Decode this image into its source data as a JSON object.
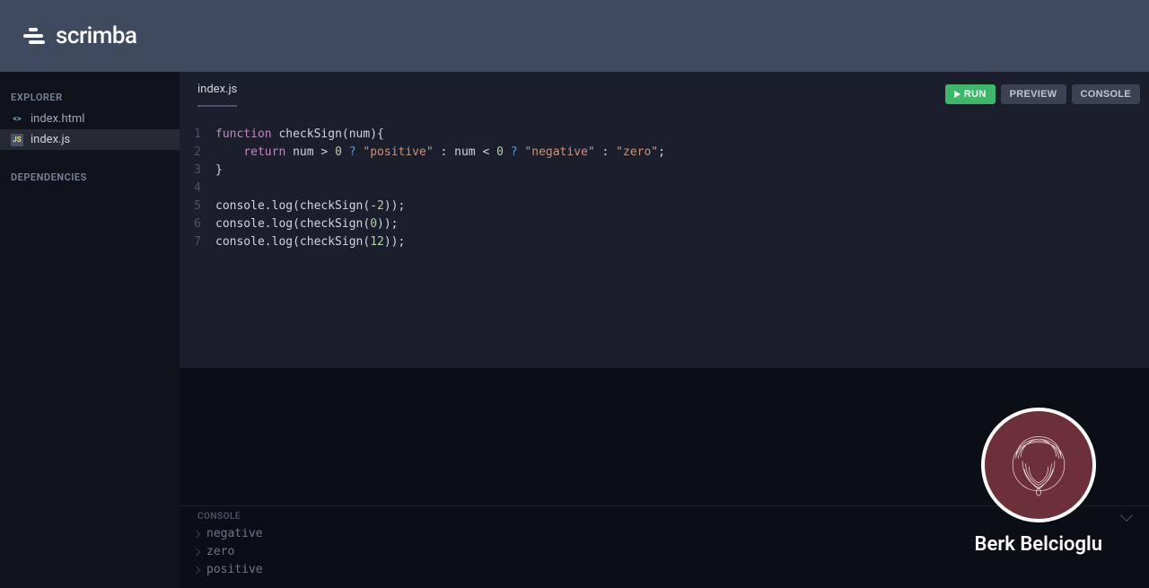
{
  "header": {
    "brand": "scrimba"
  },
  "sidebar": {
    "explorer_label": "EXPLORER",
    "dependencies_label": "DEPENDENCIES",
    "files": [
      {
        "name": "index.html",
        "icon": "html",
        "active": false
      },
      {
        "name": "index.js",
        "icon": "js",
        "active": true
      }
    ]
  },
  "editor": {
    "tab": "index.js",
    "run_label": "RUN",
    "preview_label": "PREVIEW",
    "console_label": "CONSOLE",
    "lines": {
      "l1_kw_function": "function",
      "l1_rest": " checkSign(num){",
      "l2_kw_return": "return",
      "l2_num1_pre": " num ",
      "l2_gt": ">",
      "l2_zero1": " 0 ",
      "l2_q1": "?",
      "l2_pos": " \"positive\" ",
      "l2_colon1": ":",
      "l2_num2_pre": " num ",
      "l2_lt": "<",
      "l2_zero2": " 0 ",
      "l2_q2": "?",
      "l2_neg": " \"negative\" ",
      "l2_colon2": ":",
      "l2_zero_str": " \"zero\"",
      "l2_semi": ";",
      "l3": "}",
      "l5_pre": "console.log(checkSign(-",
      "l5_num": "2",
      "l5_post": "));",
      "l6_pre": "console.log(checkSign(",
      "l6_num": "0",
      "l6_post": "));",
      "l7_pre": "console.log(checkSign(",
      "l7_num": "12",
      "l7_post": "));"
    },
    "line_numbers": [
      "1",
      "2",
      "3",
      "4",
      "5",
      "6",
      "7"
    ]
  },
  "console": {
    "title": "CONSOLE",
    "lines": [
      "negative",
      "zero",
      "positive"
    ]
  },
  "presenter": {
    "name": "Berk Belcioglu"
  }
}
